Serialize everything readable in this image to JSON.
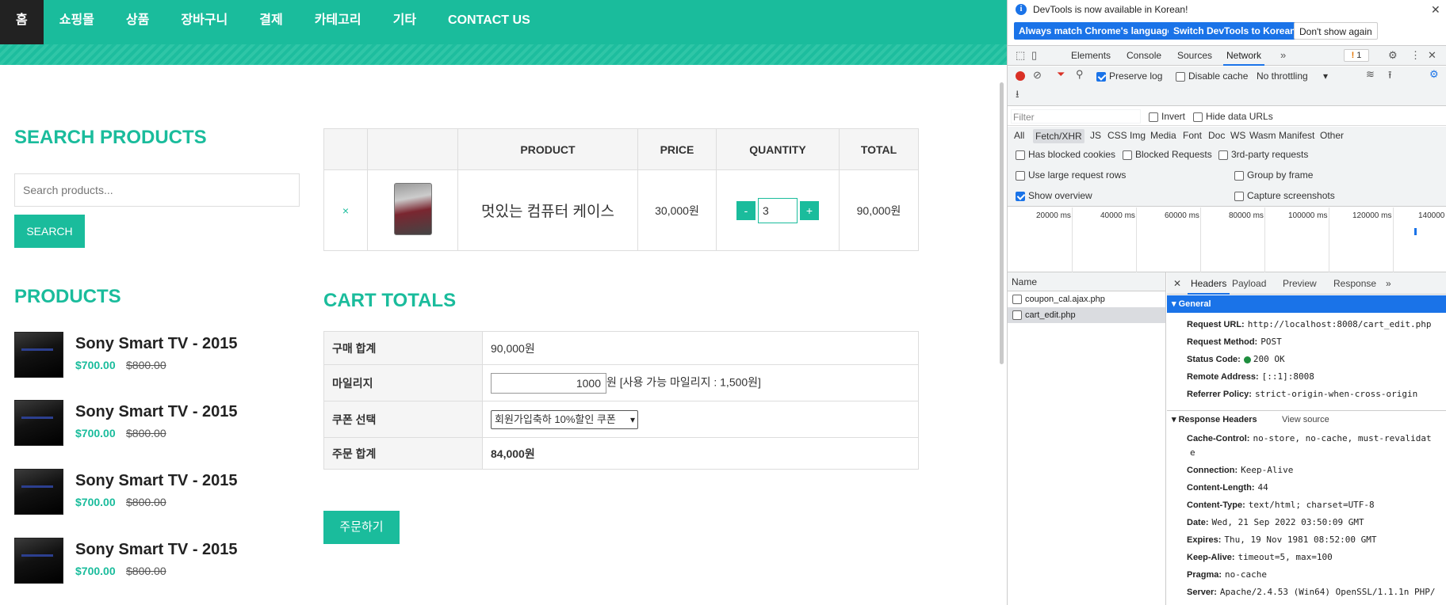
{
  "site": {
    "nav": [
      "홈",
      "쇼핑몰",
      "상품",
      "장바구니",
      "결제",
      "카테고리",
      "기타",
      "CONTACT US"
    ],
    "search": {
      "title": "SEARCH PRODUCTS",
      "placeholder": "Search products...",
      "button": "SEARCH"
    },
    "products": {
      "title": "PRODUCTS",
      "items": [
        {
          "name": "Sony Smart TV - 2015",
          "price": "$700.00",
          "old_price": "$800.00"
        },
        {
          "name": "Sony Smart TV - 2015",
          "price": "$700.00",
          "old_price": "$800.00"
        },
        {
          "name": "Sony Smart TV - 2015",
          "price": "$700.00",
          "old_price": "$800.00"
        },
        {
          "name": "Sony Smart TV - 2015",
          "price": "$700.00",
          "old_price": "$800.00"
        }
      ]
    },
    "cart": {
      "headers": [
        "",
        "",
        "PRODUCT",
        "PRICE",
        "QUANTITY",
        "TOTAL"
      ],
      "row": {
        "remove": "×",
        "product": "멋있는 컴퓨터 케이스",
        "price": "30,000원",
        "qty_minus": "-",
        "qty": "3",
        "qty_plus": "+",
        "total": "90,000원"
      }
    },
    "totals": {
      "title": "CART TOTALS",
      "rows": [
        {
          "label": "구매 합계",
          "value": "90,000원"
        },
        {
          "label": "마일리지",
          "input": "1000",
          "suffix": "원 [사용 가능 마일리지 : 1,500원]"
        },
        {
          "label": "쿠폰 선택",
          "select": "회원가입축하 10%할인 쿠폰"
        },
        {
          "label": "주문 합계",
          "value": "84,000원"
        }
      ],
      "order_button": "주문하기"
    }
  },
  "devtools": {
    "info": {
      "text": "DevTools is now available in Korean!",
      "btn1": "Always match Chrome's language",
      "btn2": "Switch DevTools to Korean",
      "btn3": "Don't show again"
    },
    "tabs": [
      "Elements",
      "Console",
      "Sources",
      "Network"
    ],
    "active_tab": "Network",
    "issues": "1",
    "toolbar": {
      "preserve_log": "Preserve log",
      "disable_cache": "Disable cache",
      "throttling": "No throttling"
    },
    "filter": {
      "placeholder": "Filter",
      "invert": "Invert",
      "hide_data_urls": "Hide data URLs"
    },
    "types": [
      "All",
      "Fetch/XHR",
      "JS",
      "CSS",
      "Img",
      "Media",
      "Font",
      "Doc",
      "WS",
      "Wasm",
      "Manifest",
      "Other"
    ],
    "options": {
      "blocked_cookies": "Has blocked cookies",
      "blocked_requests": "Blocked Requests",
      "third_party": "3rd-party requests",
      "large_rows": "Use large request rows",
      "group_frame": "Group by frame",
      "show_overview": "Show overview",
      "capture_screens": "Capture screenshots"
    },
    "ticks": [
      "20000 ms",
      "40000 ms",
      "60000 ms",
      "80000 ms",
      "100000 ms",
      "120000 ms",
      "140000"
    ],
    "name_header": "Name",
    "requests": [
      "coupon_cal.ajax.php",
      "cart_edit.php"
    ],
    "detail_tabs": [
      "Headers",
      "Payload",
      "Preview",
      "Response"
    ],
    "general": {
      "title": "General",
      "request_url_label": "Request URL:",
      "request_url": "http://localhost:8008/cart_edit.php",
      "method_label": "Request Method:",
      "method": "POST",
      "status_label": "Status Code:",
      "status": "200 OK",
      "remote_label": "Remote Address:",
      "remote": "[::1]:8008",
      "referrer_label": "Referrer Policy:",
      "referrer": "strict-origin-when-cross-origin"
    },
    "response_headers": {
      "title": "Response Headers",
      "view_source": "View source",
      "rows": [
        {
          "k": "Cache-Control:",
          "v": "no-store, no-cache, must-revalidat"
        },
        {
          "k": "",
          "v": "e"
        },
        {
          "k": "Connection:",
          "v": "Keep-Alive"
        },
        {
          "k": "Content-Length:",
          "v": "44"
        },
        {
          "k": "Content-Type:",
          "v": "text/html; charset=UTF-8"
        },
        {
          "k": "Date:",
          "v": "Wed, 21 Sep 2022 03:50:09 GMT"
        },
        {
          "k": "Expires:",
          "v": "Thu, 19 Nov 1981 08:52:00 GMT"
        },
        {
          "k": "Keep-Alive:",
          "v": "timeout=5, max=100"
        },
        {
          "k": "Pragma:",
          "v": "no-cache"
        },
        {
          "k": "Server:",
          "v": "Apache/2.4.53 (Win64) OpenSSL/1.1.1n PHP/"
        }
      ]
    }
  }
}
